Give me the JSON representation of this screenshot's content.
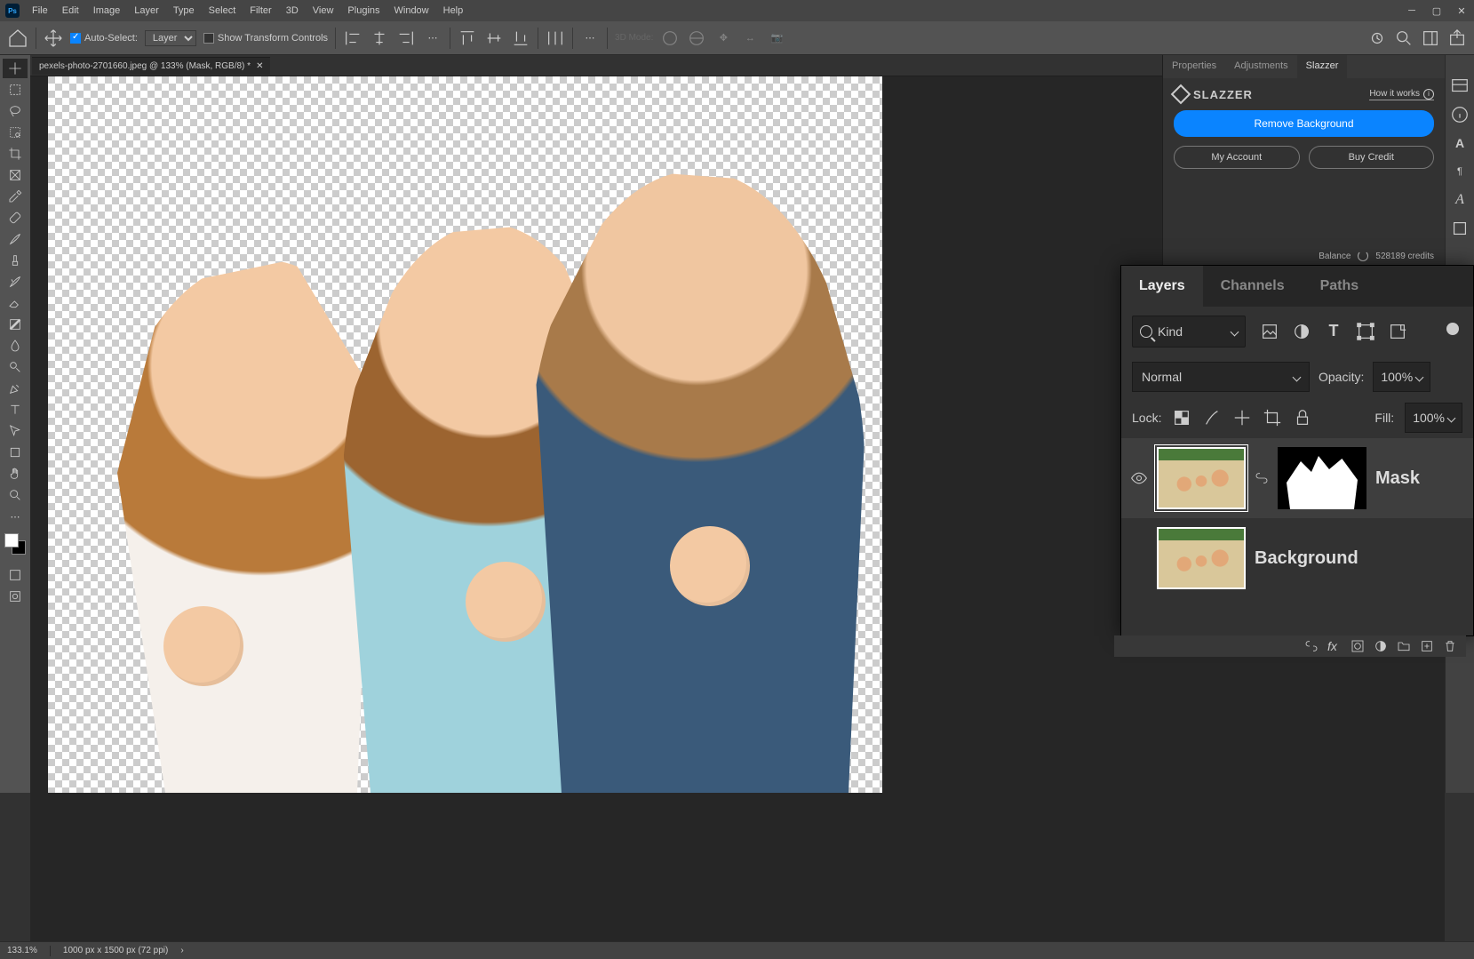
{
  "menubar": [
    "File",
    "Edit",
    "Image",
    "Layer",
    "Type",
    "Select",
    "Filter",
    "3D",
    "View",
    "Plugins",
    "Window",
    "Help"
  ],
  "optionsbar": {
    "auto_select_label": "Auto-Select:",
    "layer_dropdown": "Layer",
    "show_transform_label": "Show Transform Controls",
    "mode_3d_label": "3D Mode:"
  },
  "document_tab": {
    "title": "pexels-photo-2701660.jpeg @ 133% (Mask, RGB/8) *"
  },
  "right_panel": {
    "tabs": {
      "properties": "Properties",
      "adjustments": "Adjustments",
      "slazzer": "Slazzer"
    },
    "brand": "SLAZZER",
    "how_link": "How it works",
    "remove_btn": "Remove Background",
    "account_btn": "My Account",
    "credit_btn": "Buy Credit",
    "balance_label": "Balance",
    "balance_value": "528189 credits"
  },
  "layers_panel": {
    "tabs": {
      "layers": "Layers",
      "channels": "Channels",
      "paths": "Paths"
    },
    "kind_label": "Kind",
    "blend_mode": "Normal",
    "opacity_label": "Opacity:",
    "opacity_value": "100%",
    "lock_label": "Lock:",
    "fill_label": "Fill:",
    "fill_value": "100%",
    "layers": [
      {
        "name": "Mask",
        "eye": true,
        "selected": true,
        "has_mask": true
      },
      {
        "name": "Background",
        "eye": false,
        "selected": false,
        "has_mask": false
      }
    ]
  },
  "statusbar": {
    "zoom": "133.1%",
    "doc_info": "1000 px x 1500 px (72 ppi)"
  }
}
